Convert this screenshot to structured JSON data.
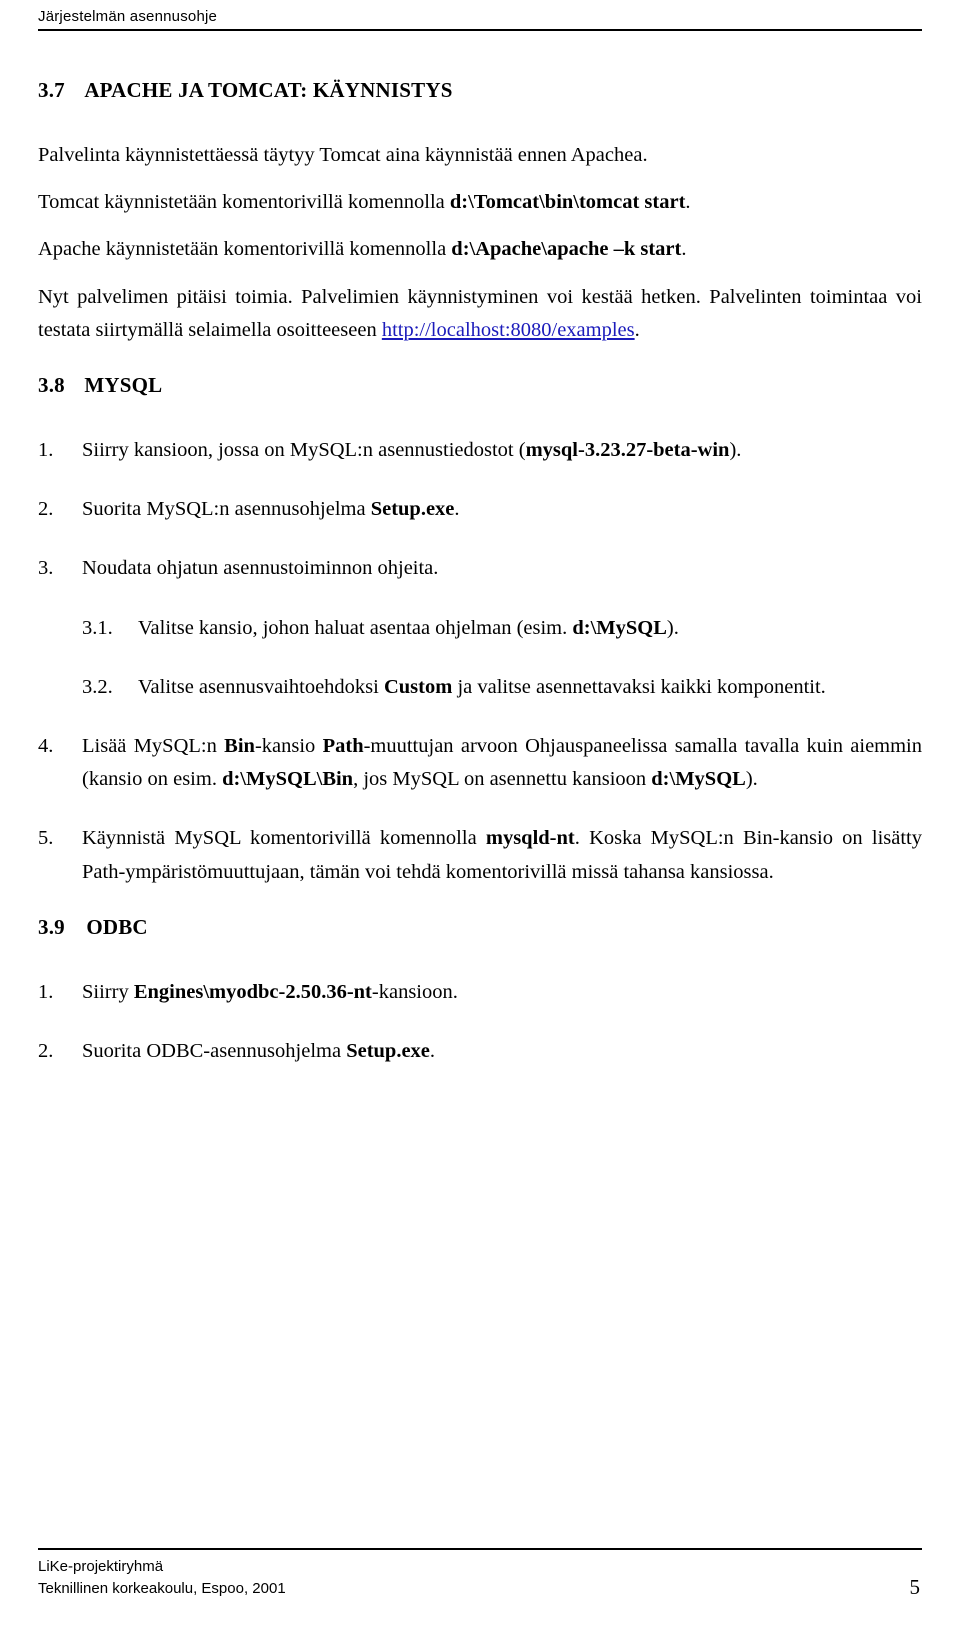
{
  "header": {
    "title": "Järjestelmän asennusohje"
  },
  "sections": {
    "s37": {
      "number": "3.7",
      "title": "APACHE JA TOMCAT: KÄYNNISTYS"
    },
    "s38": {
      "number": "3.8",
      "title": "MYSQL"
    },
    "s39": {
      "number": "3.9",
      "title": "ODBC"
    }
  },
  "paragraphs": {
    "p1": "Palvelinta käynnistettäessä täytyy Tomcat aina käynnistää ennen Apachea.",
    "p2_a": "Tomcat käynnistetään komentorivillä komennolla ",
    "p2_b": "d:\\Tomcat\\bin\\tomcat start",
    "p2_c": ".",
    "p3_a": "Apache käynnistetään komentorivillä komennolla ",
    "p3_b": "d:\\Apache\\apache –k start",
    "p3_c": ".",
    "p4_a": "Nyt palvelimen pitäisi toimia. Palvelimien käynnistyminen voi kestää hetken. Palvelinten toimintaa voi testata siirtymällä selaimella osoitteeseen ",
    "p4_link": "http://localhost:8080/examples",
    "p4_c": "."
  },
  "mysql_list": [
    {
      "marker": "1.",
      "parts": [
        {
          "t": "Siirry kansioon, jossa on MySQL:n asennustiedostot (",
          "b": false
        },
        {
          "t": "mysql-3.23.27-beta-win",
          "b": true
        },
        {
          "t": ").",
          "b": false
        }
      ]
    },
    {
      "marker": "2.",
      "parts": [
        {
          "t": "Suorita MySQL:n asennusohjelma ",
          "b": false
        },
        {
          "t": "Setup.exe",
          "b": true
        },
        {
          "t": ".",
          "b": false
        }
      ]
    },
    {
      "marker": "3.",
      "parts": [
        {
          "t": "Noudata ohjatun asennustoiminnon ohjeita.",
          "b": false
        }
      ]
    },
    {
      "marker": "3.1.",
      "sub": true,
      "parts": [
        {
          "t": "Valitse kansio, johon haluat asentaa ohjelman (esim. ",
          "b": false
        },
        {
          "t": "d:\\MySQL",
          "b": true
        },
        {
          "t": ").",
          "b": false
        }
      ]
    },
    {
      "marker": "3.2.",
      "sub": true,
      "parts": [
        {
          "t": "Valitse asennusvaihtoehdoksi ",
          "b": false
        },
        {
          "t": "Custom",
          "b": true
        },
        {
          "t": " ja valitse asennettavaksi kaikki komponentit.",
          "b": false
        }
      ]
    },
    {
      "marker": "4.",
      "parts": [
        {
          "t": "Lisää MySQL:n ",
          "b": false
        },
        {
          "t": "Bin",
          "b": true
        },
        {
          "t": "-kansio ",
          "b": false
        },
        {
          "t": "Path",
          "b": true
        },
        {
          "t": "-muuttujan arvoon Ohjauspaneelissa samalla tavalla kuin aiemmin (kansio on esim. ",
          "b": false
        },
        {
          "t": "d:\\MySQL\\Bin",
          "b": true
        },
        {
          "t": ", jos MySQL on asennettu kansioon ",
          "b": false
        },
        {
          "t": "d:\\MySQL",
          "b": true
        },
        {
          "t": ").",
          "b": false
        }
      ]
    },
    {
      "marker": "5.",
      "parts": [
        {
          "t": "Käynnistä MySQL komentorivillä komennolla ",
          "b": false
        },
        {
          "t": "mysqld-nt",
          "b": true
        },
        {
          "t": ".  Koska MySQL:n Bin-kansio on lisätty Path-ympäristömuuttujaan, tämän voi tehdä komentorivillä missä tahansa kansiossa.",
          "b": false
        }
      ]
    }
  ],
  "odbc_list": [
    {
      "marker": "1.",
      "parts": [
        {
          "t": "Siirry ",
          "b": false
        },
        {
          "t": "Engines\\myodbc-2.50.36-nt",
          "b": true
        },
        {
          "t": "-kansioon.",
          "b": false
        }
      ]
    },
    {
      "marker": "2.",
      "parts": [
        {
          "t": "Suorita ODBC-asennusohjelma ",
          "b": false
        },
        {
          "t": "Setup.exe",
          "b": true
        },
        {
          "t": ".",
          "b": false
        }
      ]
    }
  ],
  "footer": {
    "line1": "LiKe-projektiryhmä",
    "line2": "Teknillinen korkeakoulu, Espoo, 2001",
    "page_number": "5"
  },
  "colors": {
    "link": "#1b1bbb",
    "text": "#000000",
    "background": "#ffffff"
  }
}
